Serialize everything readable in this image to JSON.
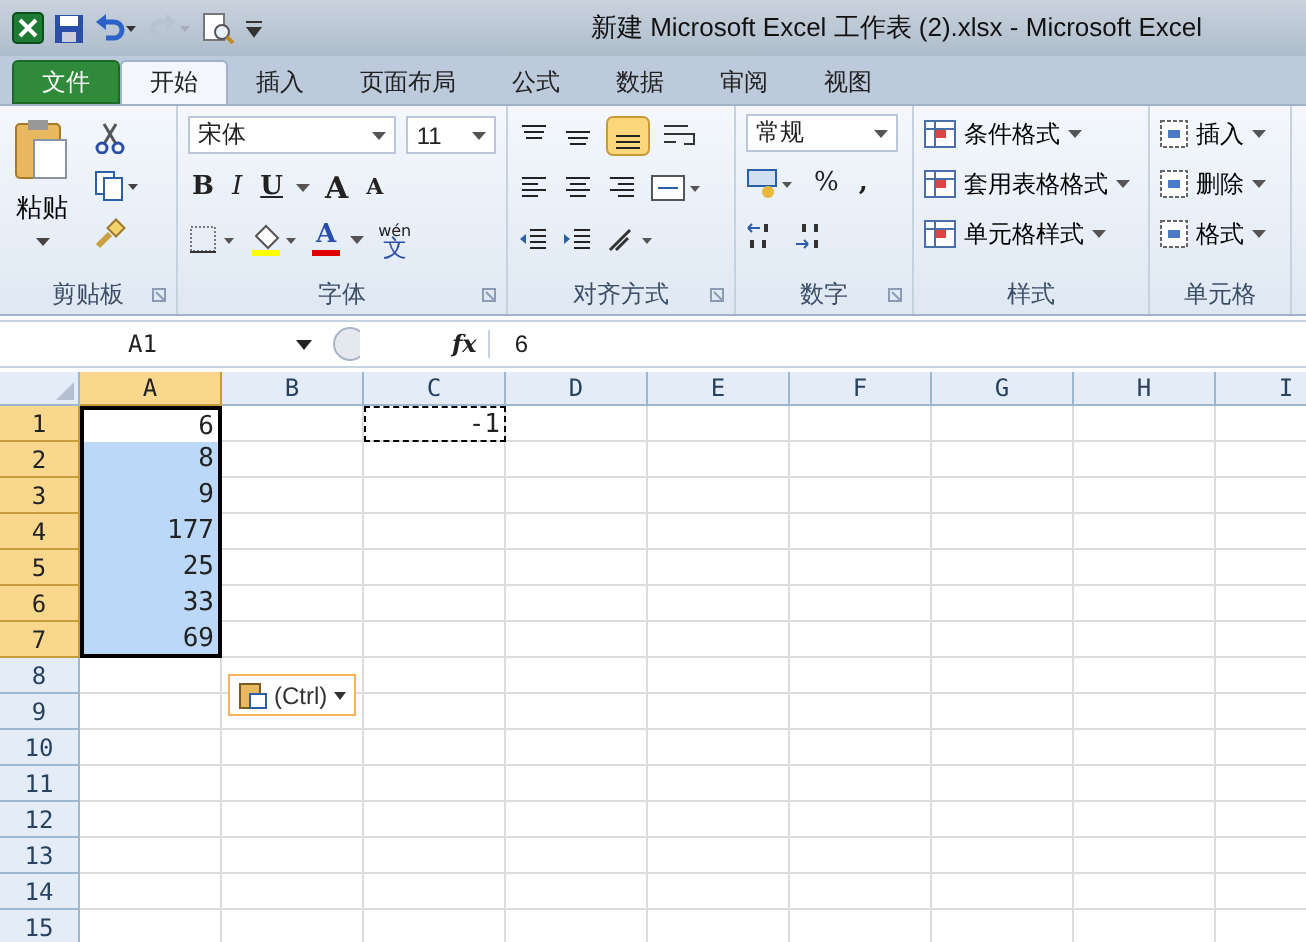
{
  "window": {
    "title": "新建 Microsoft Excel 工作表 (2).xlsx  -  Microsoft Excel"
  },
  "tabs": [
    {
      "label": "文件",
      "kind": "file",
      "selected": false
    },
    {
      "label": "开始",
      "kind": "tab",
      "selected": true
    },
    {
      "label": "插入",
      "kind": "tab",
      "selected": false
    },
    {
      "label": "页面布局",
      "kind": "tab",
      "selected": false
    },
    {
      "label": "公式",
      "kind": "tab",
      "selected": false
    },
    {
      "label": "数据",
      "kind": "tab",
      "selected": false
    },
    {
      "label": "审阅",
      "kind": "tab",
      "selected": false
    },
    {
      "label": "视图",
      "kind": "tab",
      "selected": false
    }
  ],
  "ribbon": {
    "clipboard": {
      "label": "剪贴板",
      "paste": "粘贴"
    },
    "font": {
      "label": "字体",
      "name": "宋体",
      "size": "11",
      "bold": "B",
      "italic": "I",
      "underline": "U",
      "grow": "A",
      "shrink": "A",
      "font_color_letter": "A",
      "phonetic_top": "wén",
      "phonetic": "文"
    },
    "alignment": {
      "label": "对齐方式"
    },
    "number": {
      "label": "数字",
      "format": "常规",
      "percent": "%",
      "comma": ","
    },
    "styles": {
      "label": "样式",
      "items": [
        "条件格式",
        "套用表格格式",
        "单元格样式"
      ]
    },
    "cells": {
      "label": "单元格",
      "items": [
        "插入",
        "删除",
        "格式"
      ]
    }
  },
  "formula_bar": {
    "name_box": "A1",
    "fx": "fx",
    "value": "6"
  },
  "columns": [
    {
      "label": "A",
      "selected": true
    },
    {
      "label": "B",
      "selected": false
    },
    {
      "label": "C",
      "selected": false
    },
    {
      "label": "D",
      "selected": false
    },
    {
      "label": "E",
      "selected": false
    },
    {
      "label": "F",
      "selected": false
    },
    {
      "label": "G",
      "selected": false
    },
    {
      "label": "H",
      "selected": false
    },
    {
      "label": "I",
      "selected": false
    }
  ],
  "rows": [
    {
      "header": "1",
      "selected": true,
      "cells": [
        {
          "value": "6",
          "selected": true,
          "active": true
        },
        null,
        {
          "value": "-1",
          "copied": true
        }
      ]
    },
    {
      "header": "2",
      "selected": true,
      "cells": [
        {
          "value": "8",
          "selected": true
        }
      ]
    },
    {
      "header": "3",
      "selected": true,
      "cells": [
        {
          "value": "9",
          "selected": true
        }
      ]
    },
    {
      "header": "4",
      "selected": true,
      "cells": [
        {
          "value": "177",
          "selected": true
        }
      ]
    },
    {
      "header": "5",
      "selected": true,
      "cells": [
        {
          "value": "25",
          "selected": true
        }
      ]
    },
    {
      "header": "6",
      "selected": true,
      "cells": [
        {
          "value": "33",
          "selected": true
        }
      ]
    },
    {
      "header": "7",
      "selected": true,
      "cells": [
        {
          "value": "69",
          "selected": true
        }
      ]
    },
    {
      "header": "8",
      "selected": false,
      "cells": []
    },
    {
      "header": "9",
      "selected": false,
      "cells": []
    },
    {
      "header": "10",
      "selected": false,
      "cells": []
    },
    {
      "header": "11",
      "selected": false,
      "cells": []
    },
    {
      "header": "12",
      "selected": false,
      "cells": []
    },
    {
      "header": "13",
      "selected": false,
      "cells": []
    },
    {
      "header": "14",
      "selected": false,
      "cells": []
    },
    {
      "header": "15",
      "selected": false,
      "cells": []
    }
  ],
  "paste_options": {
    "label": "(Ctrl)"
  }
}
